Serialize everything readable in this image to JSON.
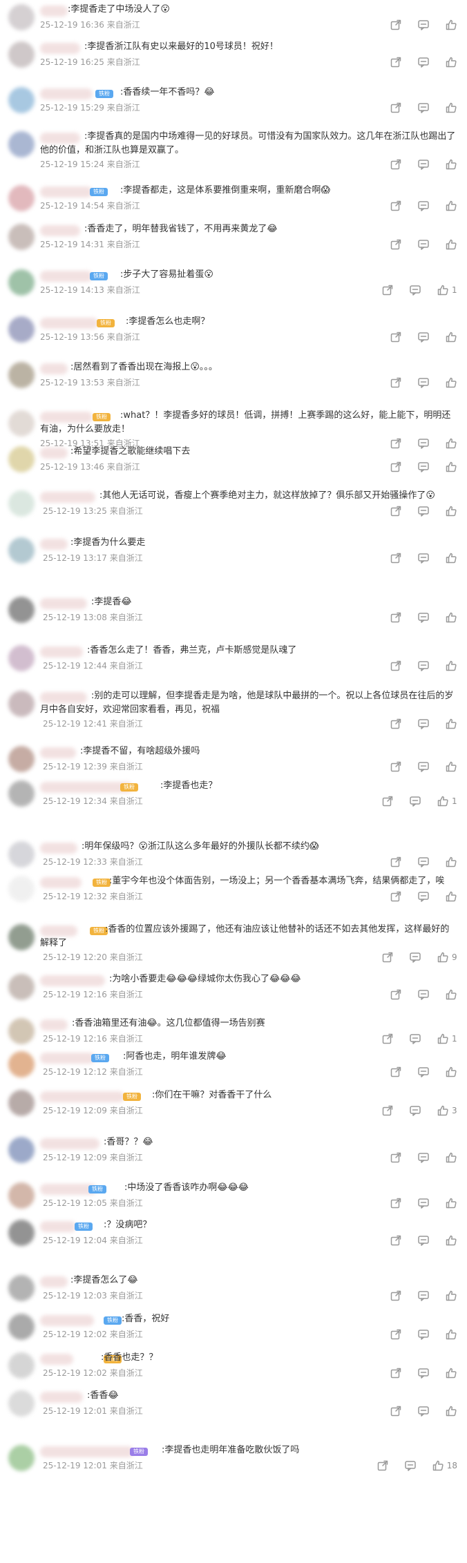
{
  "comments": [
    {
      "text": ":李提香走了中场没人了😮",
      "time": "25-12-19 16:36",
      "loc": "来自浙江",
      "likes": "",
      "badge": "",
      "badge_color": "",
      "avatar_color": "#c7c1c4"
    },
    {
      "text": ":李提香浙江队有史以来最好的10号球员！祝好！",
      "time": "25-12-19 16:25",
      "loc": "来自浙江",
      "likes": "",
      "badge": "",
      "badge_color": "",
      "avatar_color": "#bfb6b7"
    },
    {
      "text": ":香香续一年不香吗？😂",
      "time": "25-12-19 15:29",
      "loc": "来自浙江",
      "likes": "",
      "badge": "铁粉",
      "badge_color": "#5aa8f0",
      "avatar_color": "#8bb6d8"
    },
    {
      "text": ":李提香真的是国内中场难得一见的好球员。可惜没有为国家队效力。这几年在浙江队也踢出了他的价值，和浙江队也算是双赢了。",
      "time": "25-12-19 15:24",
      "loc": "来自浙江",
      "likes": "",
      "badge": "",
      "badge_color": "",
      "avatar_color": "#8e9fc4"
    },
    {
      "text": ":李提香都走，这是体系要推倒重来啊，重新磨合啊😱",
      "time": "25-12-19 14:54",
      "loc": "来自浙江",
      "likes": "",
      "badge": "铁粉",
      "badge_color": "#5aa8f0",
      "avatar_color": "#d9a2a8"
    },
    {
      "text": ":香香走了，明年替我省钱了，不用再来黄龙了😂",
      "time": "25-12-19 14:31",
      "loc": "来自浙江",
      "likes": "",
      "badge": "",
      "badge_color": "",
      "avatar_color": "#b8a9a4"
    },
    {
      "text": ":步子大了容易扯着蛋😮",
      "time": "25-12-19 14:13",
      "loc": "来自浙江",
      "likes": "1",
      "badge": "铁粉",
      "badge_color": "#5aa8f0",
      "avatar_color": "#7fae8c"
    },
    {
      "text": ":李提香怎么也走啊？",
      "time": "25-12-19 13:56",
      "loc": "来自浙江",
      "likes": "",
      "badge": "铁粉",
      "badge_color": "#f2b33d",
      "avatar_color": "#8a8fb5"
    },
    {
      "text": ":居然看到了香香出现在海报上😮。。。",
      "time": "25-12-19 13:53",
      "loc": "来自浙江",
      "likes": "",
      "badge": "",
      "badge_color": "",
      "avatar_color": "#a59a86"
    },
    {
      "text": ":what？！李提香多好的球员！低调，拼搏！上赛季踢的这么好，能上能下，明明还有油，为什么要放走！",
      "time": "25-12-19 13:51",
      "loc": "来自浙江",
      "likes": "",
      "badge": "铁粉",
      "badge_color": "#f2b33d",
      "avatar_color": "#d9cfc9"
    },
    {
      "text": ":希望李提香之歌能继续唱下去",
      "time": "25-12-19 13:46",
      "loc": "来自浙江",
      "likes": "",
      "badge": "",
      "badge_color": "",
      "avatar_color": "#d6c98f"
    },
    {
      "text": ":其他人无话可说，香瘦上个赛季绝对主力，就这样放掉了？俱乐部又开始骚操作了😮",
      "time": "25-12-19 13:25",
      "loc": "来自浙江",
      "likes": "",
      "badge": "",
      "badge_color": "",
      "avatar_color": "#cfe0d6"
    },
    {
      "text": ":李提香为什么要走",
      "time": "25-12-19 13:17",
      "loc": "来自浙江",
      "likes": "",
      "badge": "",
      "badge_color": "",
      "avatar_color": "#9ab7c2"
    },
    {
      "text": ":李提香😂",
      "time": "25-12-19 13:08",
      "loc": "来自浙江",
      "likes": "",
      "badge": "",
      "badge_color": "",
      "avatar_color": "#6f6f6f"
    },
    {
      "text": ":香香怎么走了！香香，弗兰克，卢卡斯感觉是队魂了",
      "time": "25-12-19 12:44",
      "loc": "来自浙江",
      "likes": "",
      "badge": "",
      "badge_color": "",
      "avatar_color": "#c4a9c0"
    },
    {
      "text": ":别的走可以理解，但李提香走是为啥，他是球队中最拼的一个。祝以上各位球员在往后的岁月中各自安好，欢迎常回家看看，再见，祝福",
      "time": "25-12-19 12:41",
      "loc": "来自浙江",
      "likes": "",
      "badge": "",
      "badge_color": "",
      "avatar_color": "#b9a4a8"
    },
    {
      "text": ":李提香不留，有啥超级外援吗",
      "time": "25-12-19 12:39",
      "loc": "来自浙江",
      "likes": "",
      "badge": "",
      "badge_color": "",
      "avatar_color": "#b39186"
    },
    {
      "text": ":李提香也走？",
      "time": "25-12-19 12:34",
      "loc": "来自浙江",
      "likes": "1",
      "badge": "铁粉",
      "badge_color": "#f2b33d",
      "avatar_color": "#9c9c9c"
    },
    {
      "text": ":明年保级吗？😮浙江队这么多年最好的外援队长都不续约😱",
      "time": "25-12-19 12:33",
      "loc": "来自浙江",
      "likes": "",
      "badge": "",
      "badge_color": "",
      "avatar_color": "#c9c9cf"
    },
    {
      "text": ":董宇今年也没个体面告别，一场没上；另一个香香基本满场飞奔，结果俩都走了，唉",
      "time": "25-12-19 12:32",
      "loc": "来自浙江",
      "likes": "",
      "badge": "铁粉",
      "badge_color": "#f2b33d",
      "avatar_color": "#ececec"
    },
    {
      "text": ":香香的位置应该外援踢了，他还有油应该让他替补的话还不如去其他发挥，这样最好的解释了",
      "time": "25-12-19 12:20",
      "loc": "来自浙江",
      "likes": "9",
      "badge": "铁粉",
      "badge_color": "#f2b33d",
      "avatar_color": "#6e7d6c"
    },
    {
      "text": ":为啥小香要走😂😂😂绿城你太伤我心了😂😂😂",
      "time": "25-12-19 12:16",
      "loc": "来自浙江",
      "likes": "",
      "badge": "",
      "badge_color": "",
      "avatar_color": "#b7a9a2"
    },
    {
      "text": ":香香油箱里还有油😂。这几位都值得一场告别赛",
      "time": "25-12-19 12:16",
      "loc": "来自浙江",
      "likes": "1",
      "badge": "",
      "badge_color": "",
      "avatar_color": "#c4b39c"
    },
    {
      "text": ":阿香也走，明年谁发牌😂",
      "time": "25-12-19 12:12",
      "loc": "来自浙江",
      "likes": "",
      "badge": "铁粉",
      "badge_color": "#5aa8f0",
      "avatar_color": "#d99a6c"
    },
    {
      "text": ":你们在干嘛？对香香干了什么",
      "time": "25-12-19 12:09",
      "loc": "来自浙江",
      "likes": "3",
      "badge": "铁粉",
      "badge_color": "#f2b33d",
      "avatar_color": "#a08f8c"
    },
    {
      "text": ":香哥？？😂",
      "time": "25-12-19 12:09",
      "loc": "来自浙江",
      "likes": "",
      "badge": "",
      "badge_color": "",
      "avatar_color": "#7b8db7"
    },
    {
      "text": ":中场没了香香该咋办啊😂😂😂",
      "time": "25-12-19 12:05",
      "loc": "来自浙江",
      "likes": "",
      "badge": "铁粉",
      "badge_color": "#5aa8f0",
      "avatar_color": "#c59f8e"
    },
    {
      "text": ":？没病吧？",
      "time": "25-12-19 12:04",
      "loc": "来自浙江",
      "likes": "",
      "badge": "铁粉",
      "badge_color": "#5aa8f0",
      "avatar_color": "#707070"
    },
    {
      "text": ":李提香怎么了😂",
      "time": "25-12-19 12:03",
      "loc": "来自浙江",
      "likes": "",
      "badge": "",
      "badge_color": "",
      "avatar_color": "#9a9a9a"
    },
    {
      "text": ":香香，祝好",
      "time": "25-12-19 12:02",
      "loc": "来自浙江",
      "likes": "",
      "badge": "铁粉",
      "badge_color": "#5aa8f0",
      "avatar_color": "#8e8e8e"
    },
    {
      "text": ":香香也走？？",
      "time": "25-12-19 12:02",
      "loc": "来自浙江",
      "likes": "",
      "badge": "铁粉",
      "badge_color": "#f2b33d",
      "avatar_color": "#c8c8c8"
    },
    {
      "text": ":香香😂",
      "time": "25-12-19 12:01",
      "loc": "来自浙江",
      "likes": "",
      "badge": "",
      "badge_color": "",
      "avatar_color": "#cfcfcf"
    },
    {
      "text": ":李提香也走明年准备吃散伙饭了吗",
      "time": "25-12-19 12:01",
      "loc": "来自浙江",
      "likes": "18",
      "badge": "铁粉",
      "badge_color": "#9a7ee8",
      "avatar_color": "#8fbf87"
    }
  ]
}
